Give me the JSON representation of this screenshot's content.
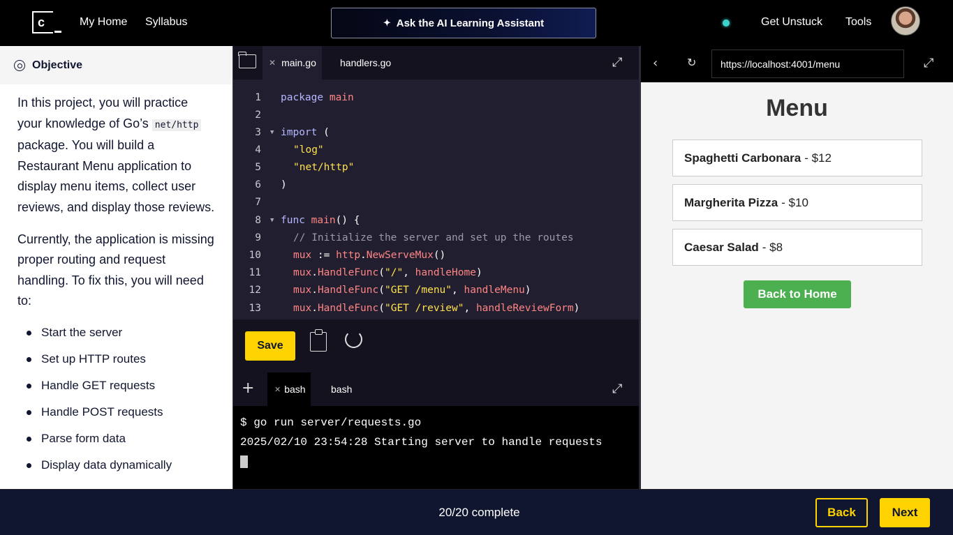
{
  "topbar": {
    "logo_text": "c",
    "nav": [
      "My Home",
      "Syllabus"
    ],
    "ai_button": "Ask the AI Learning Assistant",
    "get_unstuck": "Get Unstuck",
    "tools": "Tools"
  },
  "instructions": {
    "heading": "Objective",
    "p1_a": "In this project, you will practice your knowledge of Go’s ",
    "p1_code": "net/http",
    "p1_b": " package. You will build a Restaurant Menu application to display menu items, collect user reviews, and display those reviews.",
    "p2": "Currently, the application is missing proper routing and request handling. To fix this, you will need to:",
    "tasks": [
      "Start the server",
      "Set up HTTP routes",
      "Handle GET requests",
      "Handle POST requests",
      "Parse form data",
      "Display data dynamically"
    ]
  },
  "editor": {
    "tabs": [
      "main.go",
      "handlers.go"
    ],
    "save_label": "Save",
    "line_numbers": [
      "1",
      "2",
      "3",
      "4",
      "5",
      "6",
      "7",
      "8",
      "9",
      "10",
      "11",
      "12",
      "13"
    ],
    "code": {
      "l1_kw": "package",
      "l1_nm": "main",
      "l3_kw": "import",
      "l3_p": "(",
      "l4": "\"log\"",
      "l5": "\"net/http\"",
      "l6": ")",
      "l8_kw": "func",
      "l8_nm": "main",
      "l8_p": "() {",
      "l9": "// Initialize the server and set up the routes",
      "l10_a": "mux",
      "l10_b": " := ",
      "l10_c": "http",
      "l10_d": ".",
      "l10_e": "NewServeMux",
      "l10_f": "()",
      "l11_a": "mux",
      "l11_b": ".",
      "l11_c": "HandleFunc",
      "l11_d": "(",
      "l11_e": "\"/\"",
      "l11_f": ", ",
      "l11_g": "handleHome",
      "l11_h": ")",
      "l12_a": "mux",
      "l12_b": ".",
      "l12_c": "HandleFunc",
      "l12_d": "(",
      "l12_e": "\"GET /menu\"",
      "l12_f": ", ",
      "l12_g": "handleMenu",
      "l12_h": ")",
      "l13_a": "mux",
      "l13_b": ".",
      "l13_c": "HandleFunc",
      "l13_d": "(",
      "l13_e": "\"GET /review\"",
      "l13_f": ", ",
      "l13_g": "handleReviewForm",
      "l13_h": ")"
    }
  },
  "terminal": {
    "tabs": [
      "bash",
      "bash"
    ],
    "lines": [
      "$ go run server/requests.go",
      "2025/02/10 23:54:28 Starting server to handle requests"
    ]
  },
  "browser": {
    "url": "https://localhost:4001/menu",
    "page_title": "Menu",
    "items": [
      {
        "name": "Spaghetti Carbonara",
        "price": "- $12"
      },
      {
        "name": "Margherita Pizza",
        "price": "- $10"
      },
      {
        "name": "Caesar Salad",
        "price": "- $8"
      }
    ],
    "back_home": "Back to Home"
  },
  "footer": {
    "progress": "20/20 complete",
    "back": "Back",
    "next": "Next"
  },
  "colors": {
    "accent": "#ffd300",
    "navy": "#10162f",
    "green_button": "#4caf50",
    "status_dot": "#3fd1c9"
  }
}
